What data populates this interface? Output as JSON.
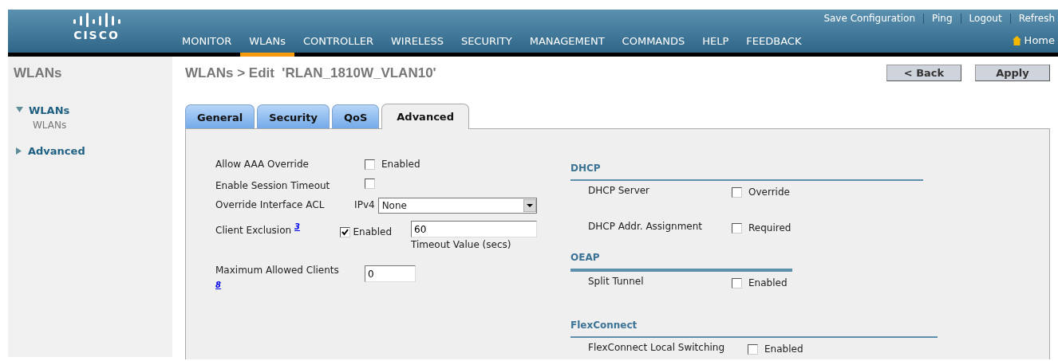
{
  "header": {
    "logo": "CISCO",
    "top_links": [
      {
        "label": "Save Configuration"
      },
      {
        "label": "Ping"
      },
      {
        "label": "Logout"
      },
      {
        "label": "Refresh"
      }
    ],
    "nav": [
      {
        "label": "MONITOR",
        "selected": false
      },
      {
        "label": "WLANs",
        "selected": true
      },
      {
        "label": "CONTROLLER",
        "selected": false
      },
      {
        "label": "WIRELESS",
        "selected": false
      },
      {
        "label": "SECURITY",
        "selected": false
      },
      {
        "label": "MANAGEMENT",
        "selected": false
      },
      {
        "label": "COMMANDS",
        "selected": false
      },
      {
        "label": "HELP",
        "selected": false
      },
      {
        "label": "FEEDBACK",
        "selected": false
      }
    ],
    "home": {
      "label": "Home"
    }
  },
  "sidebar": {
    "title": "WLANs",
    "items": [
      {
        "label": "WLANs",
        "expanded": true,
        "children": [
          {
            "label": "WLANs"
          }
        ]
      },
      {
        "label": "Advanced",
        "expanded": false
      }
    ]
  },
  "page": {
    "title": "WLANs > Edit  'RLAN_1810W_VLAN10'",
    "buttons": [
      "< Back",
      "Apply"
    ]
  },
  "tabs": [
    {
      "label": "General",
      "selected": false
    },
    {
      "label": "Security",
      "selected": false
    },
    {
      "label": "QoS",
      "selected": false
    },
    {
      "label": "Advanced",
      "selected": true
    }
  ],
  "left_fields": [
    {
      "kind": "checkbox",
      "label": "Allow AAA Override",
      "checked": false,
      "option": "Enabled"
    },
    {
      "kind": "checkbox",
      "label": "Enable Session Timeout",
      "checked": false
    },
    {
      "kind": "select",
      "label": "Override Interface ACL",
      "prefix": "IPv4",
      "value": "None"
    },
    {
      "kind": "exclusion",
      "label": "Client Exclusion",
      "footnote": "3",
      "checked": true,
      "option": "Enabled",
      "value": "60",
      "hint": "Timeout Value (secs)"
    },
    {
      "kind": "text",
      "label": "Maximum Allowed Clients",
      "footnote": "8",
      "value": "0"
    }
  ],
  "sections": [
    {
      "title": "DHCP",
      "rows": [
        {
          "label": "DHCP Server",
          "checked": false,
          "option": "Override"
        },
        {
          "label": "DHCP Addr. Assignment",
          "checked": false,
          "option": "Required"
        }
      ]
    },
    {
      "title": "OEAP",
      "rows": [
        {
          "label": "Split Tunnel",
          "checked": false,
          "option": "Enabled"
        }
      ]
    },
    {
      "title": "FlexConnect",
      "rows": [
        {
          "label": "FlexConnect Local Switching",
          "checked": false,
          "option": "Enabled"
        }
      ]
    }
  ]
}
